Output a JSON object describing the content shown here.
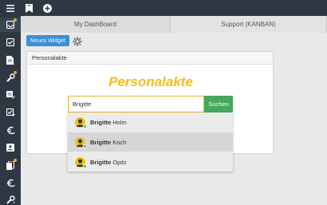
{
  "tabs": {
    "dashboard": "My DashBoard",
    "support": "Support (KANBAN)"
  },
  "toolbar": {
    "new_widget": "Neues Widget"
  },
  "panel": {
    "header": "Personalakte",
    "title": "Personalakte"
  },
  "search": {
    "value": "Brigitte",
    "button": "Suchen"
  },
  "results": [
    {
      "first": "Brigitte",
      "last": "Holm"
    },
    {
      "first": "Brigitte",
      "last": "Koch"
    },
    {
      "first": "Brigitte",
      "last": "Opitz"
    }
  ],
  "colors": {
    "sidebar": "#2f3742",
    "accent_blue": "#3a8fd7",
    "search_green": "#45a85a",
    "title_yellow": "#f2bd1c",
    "notification": "#f5a623"
  },
  "icons": {
    "topbar": [
      "bookmark-icon",
      "plus-icon"
    ],
    "sidebar": [
      "menu-icon",
      "inbox-icon",
      "check-square-icon",
      "document-icon",
      "wrench-icon",
      "document-edit-icon",
      "check-edit-icon",
      "euro-icon",
      "user-card-icon",
      "copy-icon",
      "euro-icon",
      "list-icon",
      "tools-icon"
    ],
    "settings": "gear-icon"
  }
}
